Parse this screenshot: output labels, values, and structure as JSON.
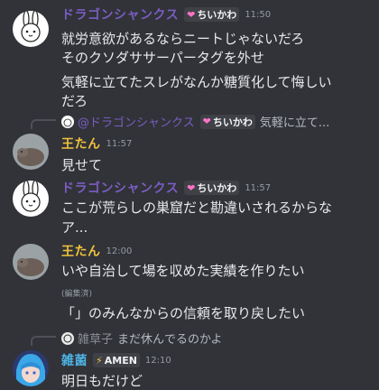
{
  "users": {
    "dragon": {
      "name": "ドラゴンシャンクス",
      "badge": "ちいかわ",
      "badge_icon": "heart-icon"
    },
    "wang": {
      "name": "王たん"
    },
    "zakin": {
      "name": "雑菌",
      "badge": "AMEN",
      "badge_icon": "lightning-icon"
    }
  },
  "messages": [
    {
      "user": "dragon",
      "time": "11:50",
      "lines": [
        "就労意欲があるならニートじゃないだろ",
        "そのクソダササーパータグを外せ",
        "気軽に立てたスレがなんか糖質化して悔しい",
        "だろ"
      ]
    },
    {
      "user": "wang",
      "time": "11:57",
      "reply": {
        "mention": "@ドラゴンシャンクス",
        "badge": "ちいかわ",
        "text": "気軽に立て..."
      },
      "lines": [
        "見せて"
      ]
    },
    {
      "user": "dragon",
      "time": "11:57",
      "lines": [
        "ここが荒らしの巣窟だと勘違いされるからな",
        "ア..."
      ]
    },
    {
      "user": "wang",
      "time": "12:00",
      "lines": [
        "いや自治して場を収めた実績を作りたい",
        "「」のみんなからの信頼を取り戻したい"
      ],
      "edited": "(編集済)"
    },
    {
      "user": "zakin",
      "time": "12:10",
      "reply": {
        "mention": "雑草子",
        "text": "まだ休んでるのかよ"
      },
      "lines": [
        "明日もだけど"
      ]
    }
  ],
  "colors": {
    "background": "#313338",
    "dragon": "#7a5dc2",
    "wang": "#f0c23b",
    "zakin": "#4fb3e6"
  }
}
